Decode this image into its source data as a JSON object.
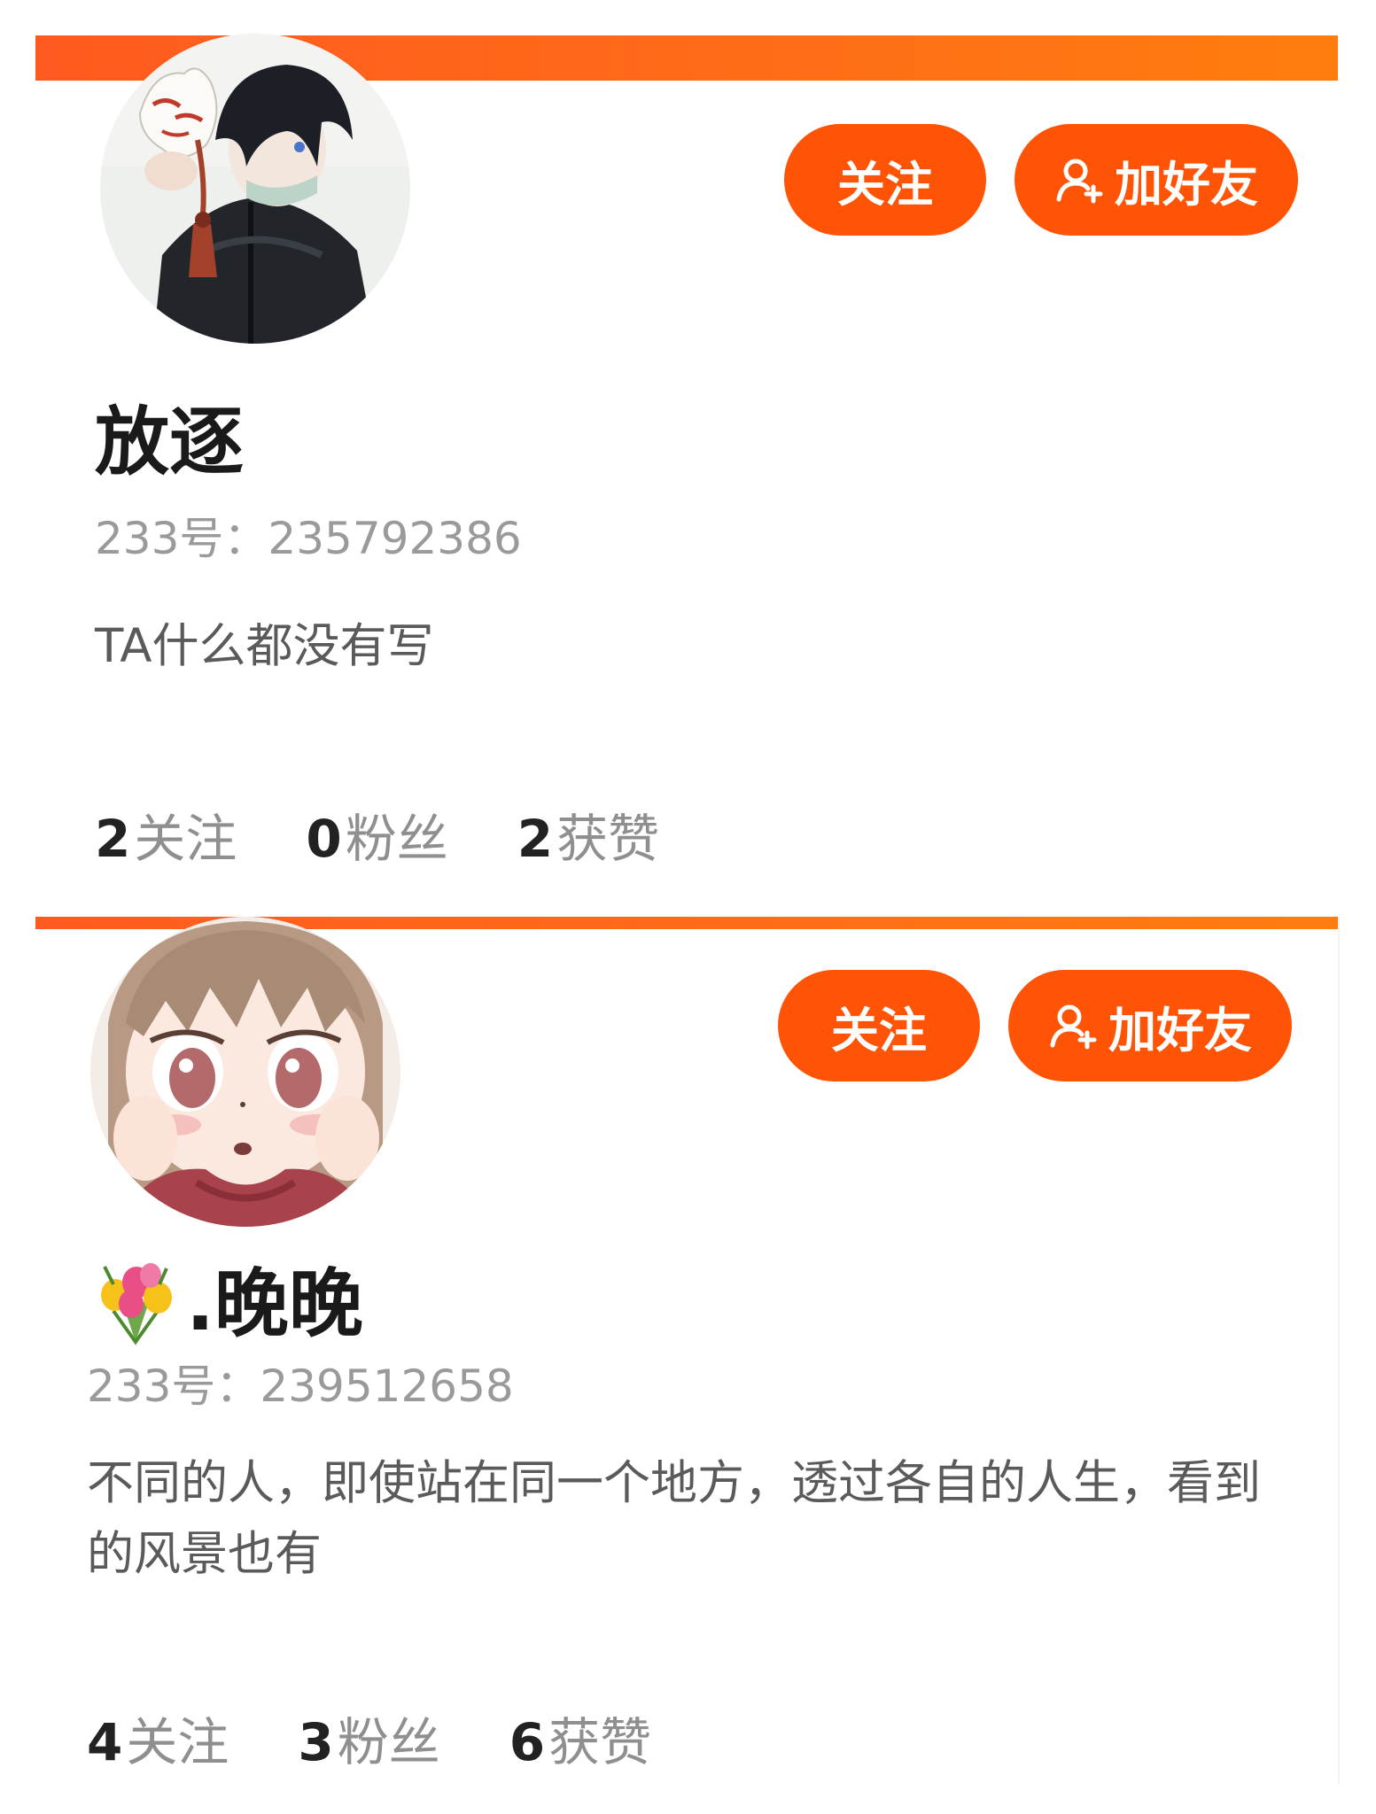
{
  "colors": {
    "accent": "#ff5306",
    "accent_bar_start": "#ff5a1f",
    "accent_bar_end": "#ff7d0e",
    "nickname_text": "#1a1a1a",
    "muted_text": "#9a9a9a",
    "bio_text": "#5a5a5a",
    "stat_number": "#222222",
    "stat_label": "#8f8f8f"
  },
  "cards": [
    {
      "avatar_icon": "avatar-masked-boy",
      "follow_label": "关注",
      "add_friend_icon": "add-user-icon",
      "add_friend_label": "加好友",
      "nickname_emoji": "",
      "nickname": "放逐",
      "uid_text": "233号：235792386",
      "bio": "TA什么都没有写",
      "stats": {
        "following": {
          "value": "2",
          "label": "关注"
        },
        "fans": {
          "value": "0",
          "label": "粉丝"
        },
        "likes": {
          "value": "2",
          "label": "获赞"
        }
      }
    },
    {
      "avatar_icon": "avatar-anime-girl",
      "follow_label": "关注",
      "add_friend_icon": "add-user-icon",
      "add_friend_label": "加好友",
      "nickname_emoji": "bouquet-icon",
      "nickname": ".晚晚",
      "uid_text": "233号：239512658",
      "bio": "不同的人，即使站在同一个地方，透过各自的人生，看到的风景也有",
      "stats": {
        "following": {
          "value": "4",
          "label": "关注"
        },
        "fans": {
          "value": "3",
          "label": "粉丝"
        },
        "likes": {
          "value": "6",
          "label": "获赞"
        }
      }
    }
  ]
}
